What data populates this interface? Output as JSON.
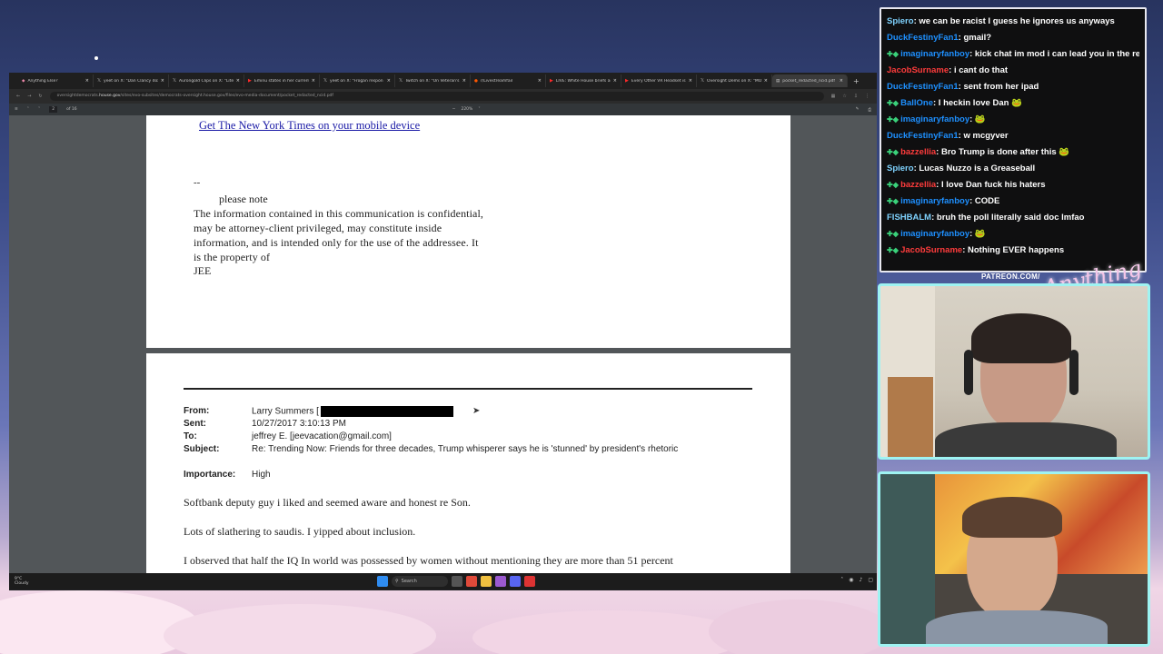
{
  "browser": {
    "tabs": [
      {
        "label": "Anything Else?",
        "icon": "app"
      },
      {
        "label": "yeet on X: \"Dan Clancy doxxe",
        "icon": "x"
      },
      {
        "label": "Aurongold Clips on X: \"Lite",
        "icon": "x"
      },
      {
        "label": "Eminu states in her current",
        "icon": "youtube"
      },
      {
        "label": "yeet on X: \"Frogan respon",
        "icon": "x"
      },
      {
        "label": "Twitch on X: \"On Veteran's D",
        "icon": "x"
      },
      {
        "label": "r/Livestreamfail",
        "icon": "reddit"
      },
      {
        "label": "LIVE: White House briefs as",
        "icon": "youtube"
      },
      {
        "label": "Every Other VR Headset is O",
        "icon": "youtube"
      },
      {
        "label": "Oversight Dems on X: \"MO",
        "icon": "x"
      },
      {
        "label": "pocket_redacted_ncid.pdf",
        "icon": "pdf",
        "active": true
      }
    ],
    "url_prefix": "oversightdemocrats.",
    "url_domain": "house.gov",
    "url_rest": "/sites/evo-subsites/democrats-oversight.house.gov/files/evo-media-document/pocket_redacted_ncid.pdf",
    "pdf_page": "2",
    "pdf_total": "of 16",
    "zoom": "220%"
  },
  "pdf": {
    "page1": {
      "link": "Get The New York Times on your mobile device",
      "dash": "--",
      "note": "please note",
      "confidential": "The information contained in this communication is confidential, may be attorney-client privileged, may constitute inside information, and is intended only for the use of the addressee. It is the property of",
      "signature": "JEE"
    },
    "page2": {
      "from_label": "From:",
      "from_value": "Larry Summers [",
      "sent_label": "Sent:",
      "sent_value": "10/27/2017 3:10:13 PM",
      "to_label": "To:",
      "to_value": "jeffrey E. [jeevacation@gmail.com]",
      "subject_label": "Subject:",
      "subject_value": "Re: Trending Now: Friends for three decades, Trump whisperer says he is 'stunned' by president's rhetoric",
      "importance_label": "Importance:",
      "importance_value": "High",
      "line1": "Softbank deputy guy i liked and seemed aware and honest re Son.",
      "line2": "Lots of slathering to saudis.  I yipped about inclusion.",
      "line3": "I observed that half the IQ In world was possessed by women without mentioning they are more than 51 percent"
    }
  },
  "taskbar": {
    "weather_temp": "9°C",
    "weather_desc": "Cloudy",
    "search": "Search"
  },
  "chat": {
    "messages": [
      {
        "user": "Spiero",
        "color": "#7fd3ff",
        "text": "we can be racist I guess he ignores us anyways",
        "badge": false
      },
      {
        "user": "DuckFestinyFan1",
        "color": "#1e90ff",
        "text": "gmail?",
        "badge": false
      },
      {
        "user": "imaginaryfanboy",
        "color": "#1e90ff",
        "text": "kick chat im mod i can lead you in the resistance, but you have to love dan",
        "badge": true
      },
      {
        "user": "JacobSurname",
        "color": "#ff3c3c",
        "text": "i cant do that",
        "badge": false
      },
      {
        "user": "DuckFestinyFan1",
        "color": "#1e90ff",
        "text": "sent from her ipad",
        "badge": false
      },
      {
        "user": "BallOne",
        "color": "#1e90ff",
        "text": "I heckin love Dan 🐸",
        "badge": true
      },
      {
        "user": "imaginaryfanboy",
        "color": "#1e90ff",
        "text": "🐸",
        "badge": true
      },
      {
        "user": "DuckFestinyFan1",
        "color": "#1e90ff",
        "text": "w mcgyver",
        "badge": false
      },
      {
        "user": "bazzellia",
        "color": "#ff3c3c",
        "text": "Bro Trump is done after this 🐸",
        "badge": true
      },
      {
        "user": "Spiero",
        "color": "#7fd3ff",
        "text": "Lucas Nuzzo is a Greaseball",
        "badge": false
      },
      {
        "user": "bazzellia",
        "color": "#ff3c3c",
        "text": "I love Dan fuck his haters",
        "badge": true
      },
      {
        "user": "imaginaryfanboy",
        "color": "#1e90ff",
        "text": "CODE",
        "badge": true
      },
      {
        "user": "FISHBALM",
        "color": "#7fd3ff",
        "text": "bruh the poll literally said doc lmfao",
        "badge": false
      },
      {
        "user": "imaginaryfanboy",
        "color": "#1e90ff",
        "text": "🐸",
        "badge": true
      },
      {
        "user": "JacobSurname",
        "color": "#ff3c3c",
        "text": "Nothing EVER happens",
        "badge": true
      }
    ]
  },
  "overlay": {
    "patreon": "PATREON.COM/",
    "logo": "Anything Else?"
  }
}
